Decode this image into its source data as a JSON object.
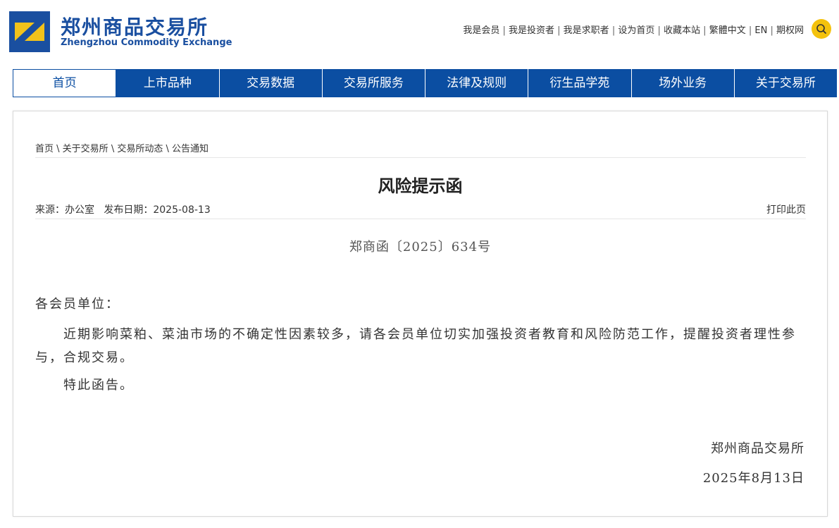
{
  "header": {
    "logo_cn": "郑州商品交易所",
    "logo_en": "Zhengzhou Commodity Exchange",
    "toplinks": [
      "我是会员",
      "我是投资者",
      "我是求职者",
      "设为首页",
      "收藏本站",
      "繁體中文",
      "EN",
      "期权网"
    ]
  },
  "nav": {
    "items": [
      "首页",
      "上市品种",
      "交易数据",
      "交易所服务",
      "法律及规则",
      "衍生品学苑",
      "场外业务",
      "关于交易所"
    ],
    "active_index": 0
  },
  "breadcrumb": [
    "首页",
    "关于交易所",
    "交易所动态",
    "公告通知"
  ],
  "article": {
    "title": "风险提示函",
    "source_label": "来源：",
    "source": "办公室",
    "date_label": "发布日期：",
    "date": "2025-08-13",
    "print": "打印此页",
    "doc_no": "郑商函〔2025〕634号",
    "salutation": "各会员单位：",
    "paragraphs": [
      "近期影响菜粕、菜油市场的不确定性因素较多，请各会员单位切实加强投资者教育和风险防范工作，提醒投资者理性参与，合规交易。",
      "特此函告。"
    ],
    "signature": "郑州商品交易所",
    "sign_date": "2025年8月13日"
  },
  "colors": {
    "brand_blue": "#0b4ea2",
    "search_yellow": "#f4c20d"
  }
}
